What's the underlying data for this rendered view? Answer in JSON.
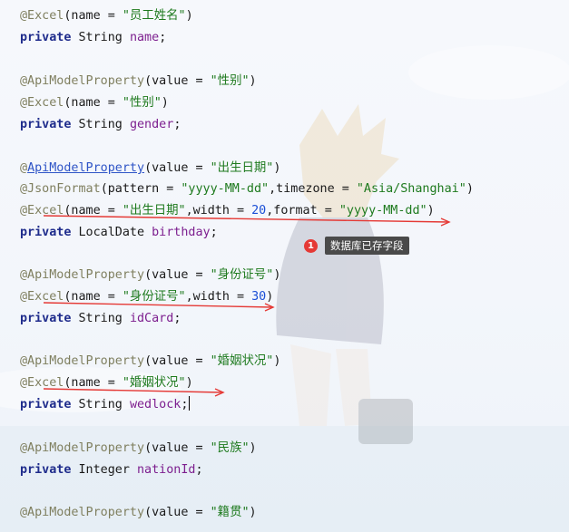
{
  "code_lines": [
    {
      "tokens": [
        {
          "t": "@Excel",
          "c": "ann"
        },
        {
          "t": "(name = ",
          "c": "plain"
        },
        {
          "t": "\"员工姓名\"",
          "c": "str"
        },
        {
          "t": ")",
          "c": "plain"
        }
      ]
    },
    {
      "tokens": [
        {
          "t": "private",
          "c": "kw"
        },
        {
          "t": " String ",
          "c": "plain"
        },
        {
          "t": "name",
          "c": "field"
        },
        {
          "t": ";",
          "c": "plain"
        }
      ]
    },
    {
      "tokens": []
    },
    {
      "tokens": [
        {
          "t": "@ApiModelProperty",
          "c": "ann"
        },
        {
          "t": "(value = ",
          "c": "plain"
        },
        {
          "t": "\"性别\"",
          "c": "str"
        },
        {
          "t": ")",
          "c": "plain"
        }
      ]
    },
    {
      "tokens": [
        {
          "t": "@Excel",
          "c": "ann"
        },
        {
          "t": "(name = ",
          "c": "plain"
        },
        {
          "t": "\"性别\"",
          "c": "str"
        },
        {
          "t": ")",
          "c": "plain"
        }
      ]
    },
    {
      "tokens": [
        {
          "t": "private",
          "c": "kw"
        },
        {
          "t": " String ",
          "c": "plain"
        },
        {
          "t": "gender",
          "c": "field"
        },
        {
          "t": ";",
          "c": "plain"
        }
      ]
    },
    {
      "tokens": []
    },
    {
      "tokens": [
        {
          "t": "@",
          "c": "ann"
        },
        {
          "t": "ApiModelProperty",
          "c": "ann-link"
        },
        {
          "t": "(value = ",
          "c": "plain"
        },
        {
          "t": "\"出生日期\"",
          "c": "str"
        },
        {
          "t": ")",
          "c": "plain"
        }
      ]
    },
    {
      "tokens": [
        {
          "t": "@JsonFormat",
          "c": "ann"
        },
        {
          "t": "(pattern = ",
          "c": "plain"
        },
        {
          "t": "\"yyyy-MM-dd\"",
          "c": "str"
        },
        {
          "t": ",timezone = ",
          "c": "plain"
        },
        {
          "t": "\"Asia/Shanghai\"",
          "c": "str"
        },
        {
          "t": ")",
          "c": "plain"
        }
      ]
    },
    {
      "tokens": [
        {
          "t": "@Excel",
          "c": "ann"
        },
        {
          "t": "(name = ",
          "c": "plain"
        },
        {
          "t": "\"出生日期\"",
          "c": "str"
        },
        {
          "t": ",width = ",
          "c": "plain"
        },
        {
          "t": "20",
          "c": "num"
        },
        {
          "t": ",format = ",
          "c": "plain"
        },
        {
          "t": "\"yyyy-MM-dd\"",
          "c": "str"
        },
        {
          "t": ")",
          "c": "plain"
        }
      ]
    },
    {
      "tokens": [
        {
          "t": "private",
          "c": "kw"
        },
        {
          "t": " LocalDate ",
          "c": "plain"
        },
        {
          "t": "birthday",
          "c": "field"
        },
        {
          "t": ";",
          "c": "plain"
        }
      ]
    },
    {
      "tokens": []
    },
    {
      "tokens": [
        {
          "t": "@ApiModelProperty",
          "c": "ann"
        },
        {
          "t": "(value = ",
          "c": "plain"
        },
        {
          "t": "\"身份证号\"",
          "c": "str"
        },
        {
          "t": ")",
          "c": "plain"
        }
      ]
    },
    {
      "tokens": [
        {
          "t": "@Excel",
          "c": "ann"
        },
        {
          "t": "(name = ",
          "c": "plain"
        },
        {
          "t": "\"身份证号\"",
          "c": "str"
        },
        {
          "t": ",width = ",
          "c": "plain"
        },
        {
          "t": "30",
          "c": "num"
        },
        {
          "t": ")",
          "c": "plain"
        }
      ]
    },
    {
      "tokens": [
        {
          "t": "private",
          "c": "kw"
        },
        {
          "t": " String ",
          "c": "plain"
        },
        {
          "t": "idCard",
          "c": "field"
        },
        {
          "t": ";",
          "c": "plain"
        }
      ]
    },
    {
      "tokens": []
    },
    {
      "tokens": [
        {
          "t": "@ApiModelProperty",
          "c": "ann"
        },
        {
          "t": "(value = ",
          "c": "plain"
        },
        {
          "t": "\"婚姻状况\"",
          "c": "str"
        },
        {
          "t": ")",
          "c": "plain"
        }
      ]
    },
    {
      "tokens": [
        {
          "t": "@Excel",
          "c": "ann"
        },
        {
          "t": "(name = ",
          "c": "plain"
        },
        {
          "t": "\"婚姻状况\"",
          "c": "str"
        },
        {
          "t": ")",
          "c": "plain"
        }
      ]
    },
    {
      "tokens": [
        {
          "t": "private",
          "c": "kw"
        },
        {
          "t": " String ",
          "c": "plain"
        },
        {
          "t": "wedlock",
          "c": "field"
        },
        {
          "t": ";",
          "c": "plain"
        }
      ],
      "caret": true
    },
    {
      "tokens": []
    },
    {
      "tokens": [
        {
          "t": "@ApiModelProperty",
          "c": "ann"
        },
        {
          "t": "(value = ",
          "c": "plain"
        },
        {
          "t": "\"民族\"",
          "c": "str"
        },
        {
          "t": ")",
          "c": "plain"
        }
      ]
    },
    {
      "tokens": [
        {
          "t": "private",
          "c": "kw"
        },
        {
          "t": " Integer ",
          "c": "plain"
        },
        {
          "t": "nationId",
          "c": "field"
        },
        {
          "t": ";",
          "c": "plain"
        }
      ]
    },
    {
      "tokens": []
    },
    {
      "tokens": [
        {
          "t": "@ApiModelProperty",
          "c": "ann"
        },
        {
          "t": "(value = ",
          "c": "plain"
        },
        {
          "t": "\"籍贯\"",
          "c": "str"
        },
        {
          "t": ")",
          "c": "plain"
        }
      ]
    }
  ],
  "tooltip": {
    "badge": "1",
    "text": "数据库已存字段"
  },
  "colors": {
    "annotation_marks": "#e53935"
  }
}
